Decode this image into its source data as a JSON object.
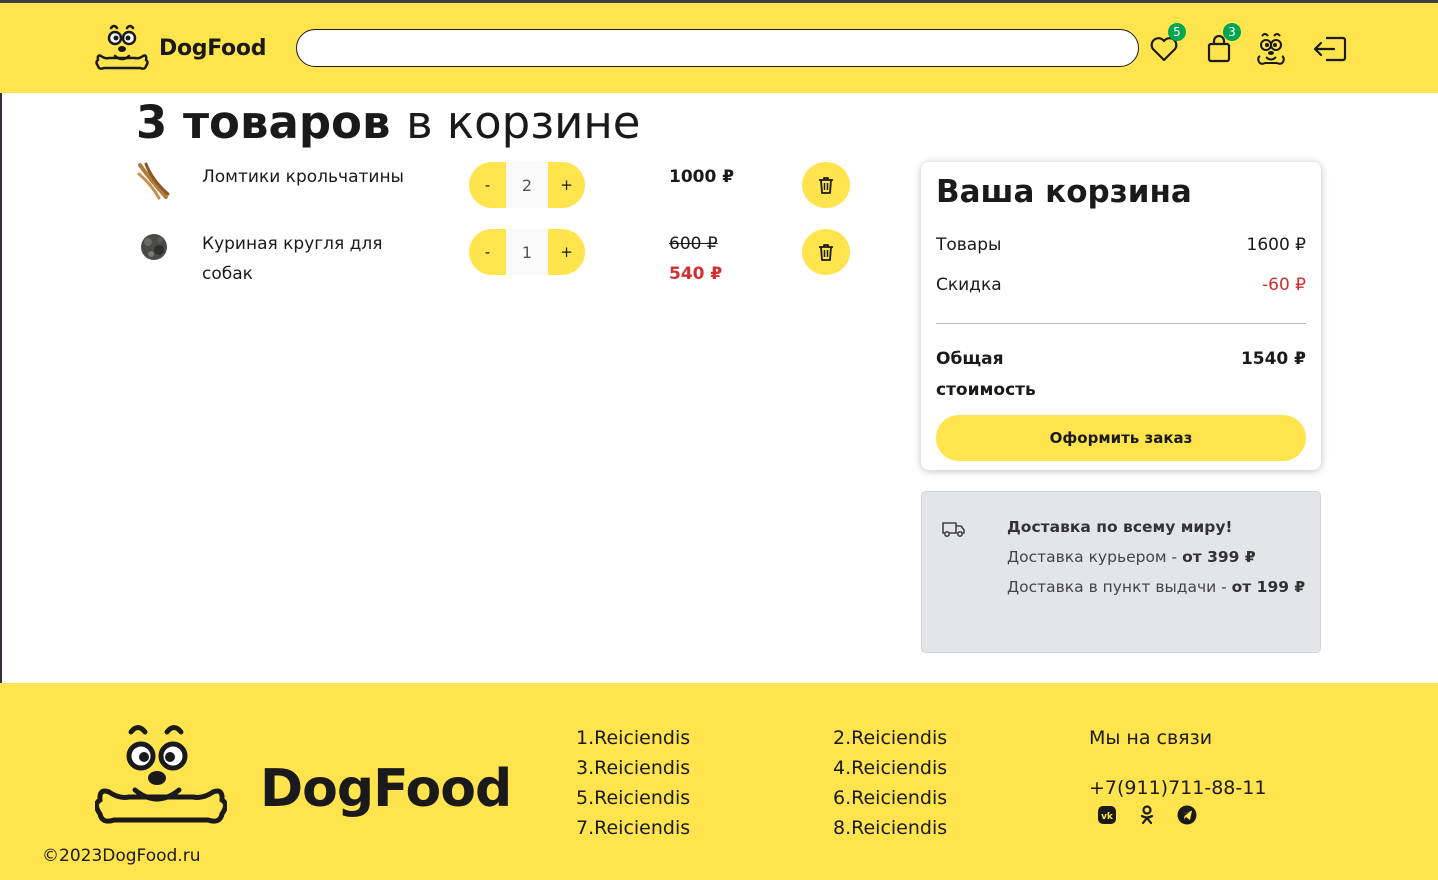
{
  "header": {
    "logo_text": "DogFood",
    "search": {
      "value": "",
      "placeholder": ""
    },
    "favorites_count": "5",
    "cart_count": "3"
  },
  "cart": {
    "title_count": "3 товаров",
    "title_rest": "в корзине",
    "items": [
      {
        "name": "Ломтики крольчатины",
        "quantity": "2",
        "price": "1000 ₽",
        "old_price": "",
        "new_price": ""
      },
      {
        "name": "Куриная кругля для собак",
        "quantity": "1",
        "price": "",
        "old_price": "600 ₽",
        "new_price": "540 ₽"
      }
    ],
    "minus_label": "-",
    "plus_label": "+"
  },
  "summary": {
    "title": "Ваша корзина",
    "goods_label": "Товары",
    "goods_value": "1600 ₽",
    "discount_label": "Скидка",
    "discount_value": "-60 ₽",
    "total_label": "Общая стоимость",
    "total_value": "1540 ₽",
    "order_button": "Оформить заказ"
  },
  "delivery": {
    "title": "Доставка по всему миру!",
    "courier_label": "Доставка курьером - ",
    "courier_price": "от 399 ₽",
    "pickup_label": "Доставка в пункт выдачи - ",
    "pickup_price": "от 199 ₽"
  },
  "footer": {
    "logo_text": "DogFood",
    "copyright": "©2023DogFood.ru",
    "links_col1": [
      "1.Reiciendis",
      "3.Reiciendis",
      "5.Reiciendis",
      "7.Reiciendis"
    ],
    "links_col2": [
      "2.Reiciendis",
      "4.Reiciendis",
      "6.Reiciendis",
      "8.Reiciendis"
    ],
    "contacts_title": "Мы на связи",
    "phone": "+7(911)711-88-11",
    "socials": [
      "vk-icon",
      "odnoklassniki-icon",
      "telegram-icon"
    ]
  },
  "colors": {
    "brand_yellow": "#ffe44d",
    "badge_green": "#00a550",
    "discount_red": "#d32f2f"
  }
}
